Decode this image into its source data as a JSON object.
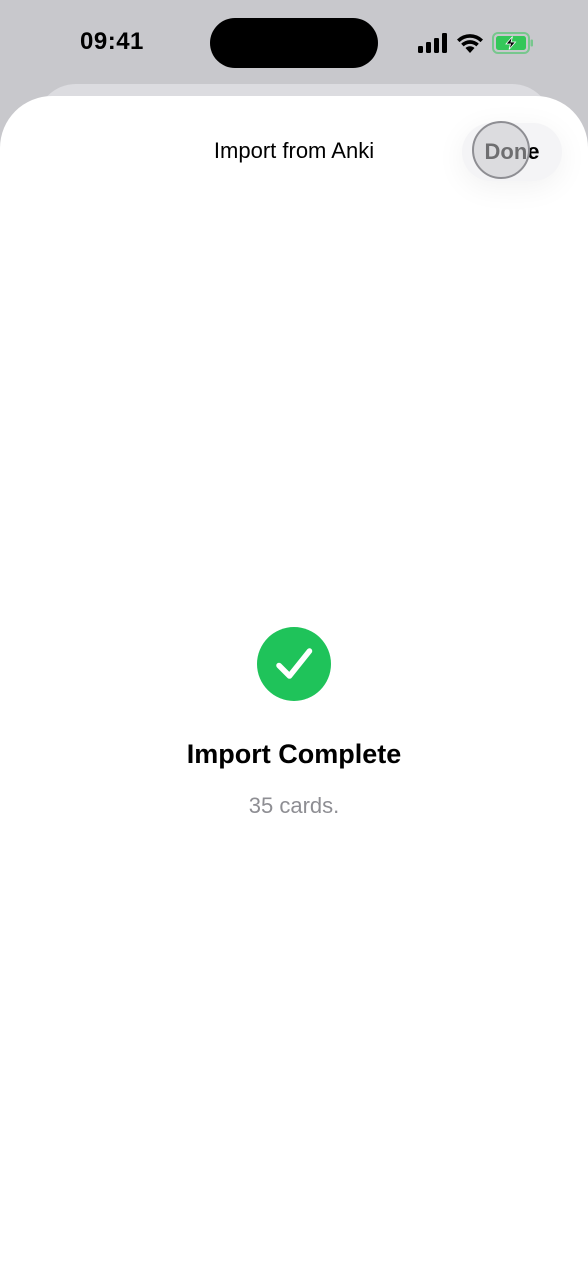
{
  "status_bar": {
    "time": "09:41",
    "icons": [
      "cellular-signal-icon",
      "wifi-icon",
      "battery-charging-icon"
    ],
    "battery_color": "#34c759"
  },
  "nav": {
    "title": "Import from Anki",
    "done_label": "Done"
  },
  "result": {
    "icon": "checkmark-circle-icon",
    "icon_color": "#1fc35a",
    "title": "Import Complete",
    "subtitle": "35 cards."
  }
}
